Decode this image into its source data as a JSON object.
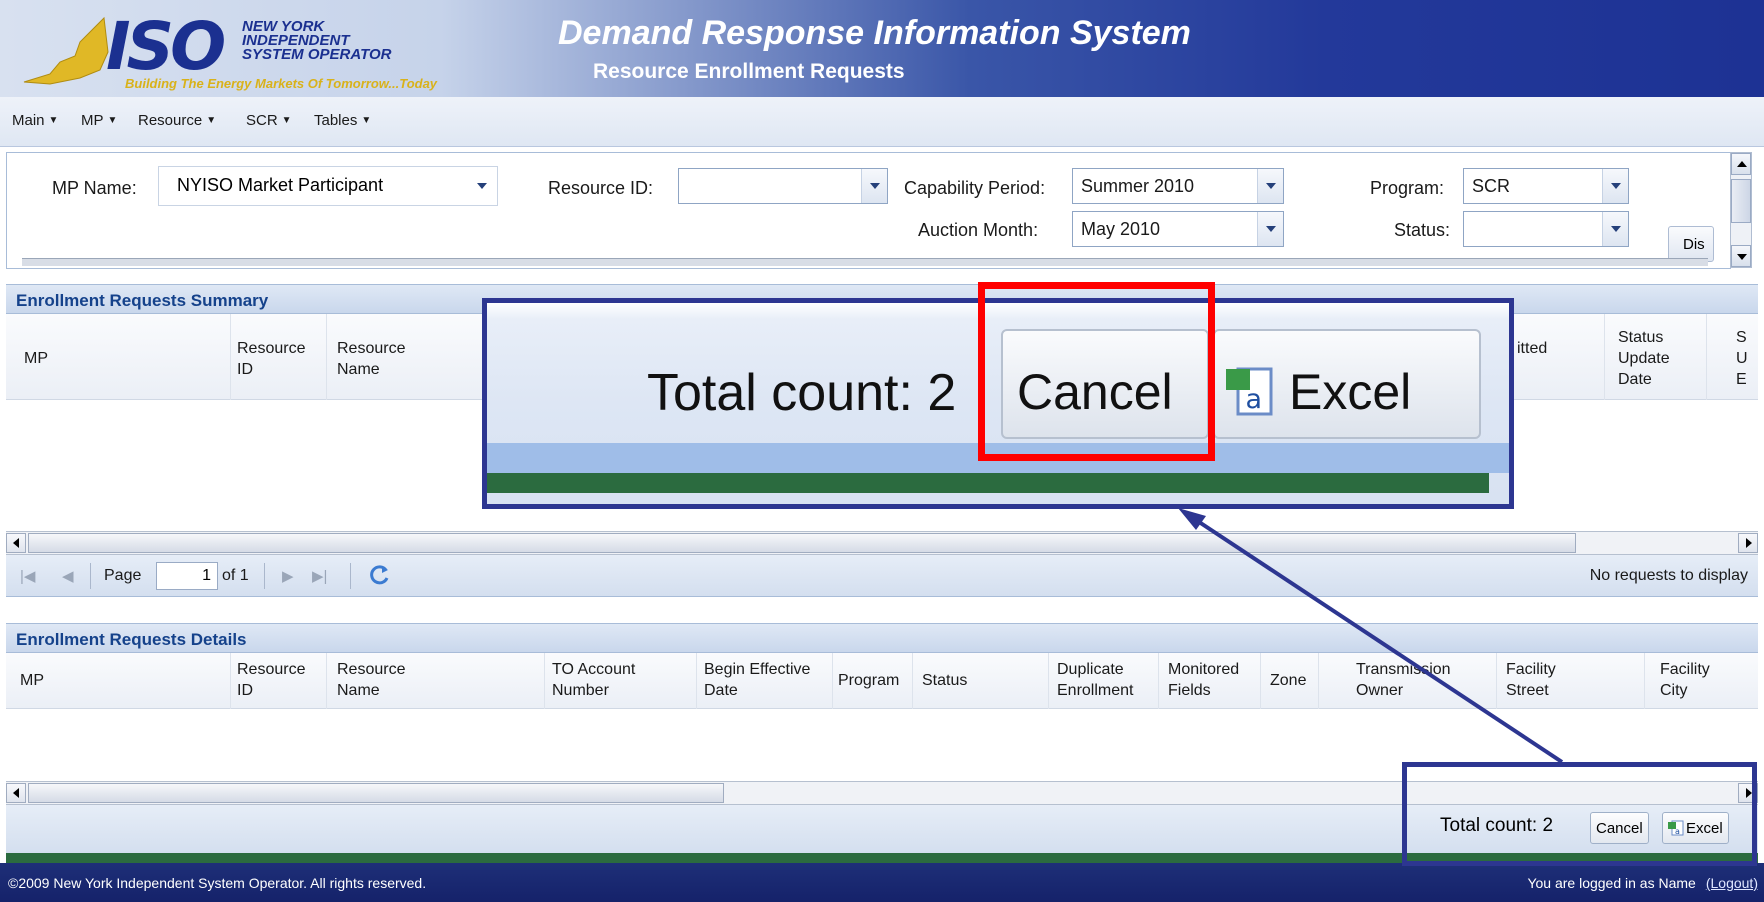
{
  "header": {
    "logo_iso": "ISO",
    "logo_name_line1": "NEW YORK",
    "logo_name_line2": "INDEPENDENT",
    "logo_name_line3": "SYSTEM OPERATOR",
    "logo_tagline": "Building The Energy Markets Of Tomorrow...Today",
    "app_title": "Demand Response Information System",
    "page_subtitle": "Resource Enrollment Requests"
  },
  "menu": [
    "Main",
    "MP",
    "Resource",
    "SCR",
    "Tables"
  ],
  "filters": {
    "mp_name_label": "MP Name:",
    "mp_name_value": "NYISO Market Participant",
    "resource_id_label": "Resource ID:",
    "resource_id_value": "",
    "capability_period_label": "Capability Period:",
    "capability_period_value": "Summer 2010",
    "auction_month_label": "Auction Month:",
    "auction_month_value": "May 2010",
    "program_label": "Program:",
    "program_value": "SCR",
    "status_label": "Status:",
    "status_value": "",
    "display_button": "Dis"
  },
  "summary": {
    "title": "Enrollment Requests Summary",
    "columns": {
      "mp": "MP",
      "resource_id_1": "Resource",
      "resource_id_2": "ID",
      "resource_name_1": "Resource",
      "resource_name_2": "Name",
      "submitted": "itted",
      "status_update_1": "Status",
      "status_update_2": "Update",
      "status_update_3": "Date",
      "cut_1": "S",
      "cut_2": "U",
      "cut_3": "E"
    },
    "pager": {
      "page_label": "Page",
      "page_value": "1",
      "of_label": "of 1",
      "empty_message": "No requests to display"
    }
  },
  "details": {
    "title": "Enrollment Requests Details",
    "columns": [
      [
        "MP"
      ],
      [
        "Resource",
        "ID"
      ],
      [
        "Resource",
        "Name"
      ],
      [
        "TO Account",
        "Number"
      ],
      [
        "Begin Effective",
        "Date"
      ],
      [
        "Program"
      ],
      [
        "Status"
      ],
      [
        "Duplicate",
        "Enrollment"
      ],
      [
        "Monitored",
        "Fields"
      ],
      [
        "Zone"
      ],
      [
        "Transmission",
        "Owner"
      ],
      [
        "Facility",
        "Street"
      ],
      [
        "Facility",
        "City"
      ]
    ],
    "total_count_label": "Total count: 2",
    "cancel_button": "Cancel",
    "excel_button": "Excel"
  },
  "zoom_callout": {
    "total_count_label": "Total count: 2",
    "cancel_button": "Cancel",
    "excel_button": "Excel"
  },
  "statusbar": {
    "copyright": "©2009   New York Independent System Operator. All rights reserved.",
    "logged_in": "You are logged in as    Name",
    "logout": "(Logout)"
  },
  "colors": {
    "header_dark": "#1d3294",
    "panel_title": "#15428b",
    "highlight_red": "#ff0000",
    "callout_blue": "#2d3691",
    "footer_green": "#2b6b3f"
  }
}
